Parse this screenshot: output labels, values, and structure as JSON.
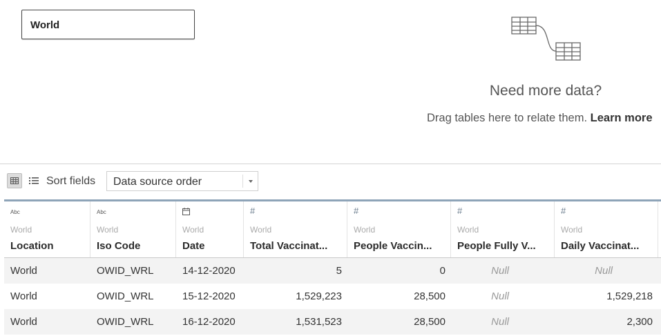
{
  "canvas": {
    "table_name": "World",
    "need_more_title": "Need more data?",
    "drag_hint": "Drag tables here to relate them.",
    "learn_more": "Learn more"
  },
  "toolbar": {
    "sort_label": "Sort fields",
    "sort_value": "Data source order"
  },
  "grid": {
    "columns": [
      {
        "type_label": "Abc",
        "source": "World",
        "name": "Location"
      },
      {
        "type_label": "Abc",
        "source": "World",
        "name": "Iso Code"
      },
      {
        "type_label": "calendar-icon",
        "source": "World",
        "name": "Date"
      },
      {
        "type_label": "#",
        "source": "World",
        "name": "Total Vaccinat..."
      },
      {
        "type_label": "#",
        "source": "World",
        "name": "People Vaccin..."
      },
      {
        "type_label": "#",
        "source": "World",
        "name": "People Fully V..."
      },
      {
        "type_label": "#",
        "source": "World",
        "name": "Daily Vaccinat..."
      }
    ],
    "rows": [
      [
        "World",
        "OWID_WRL",
        "14-12-2020",
        "5",
        "0",
        "Null",
        "Null"
      ],
      [
        "World",
        "OWID_WRL",
        "15-12-2020",
        "1,529,223",
        "28,500",
        "Null",
        "1,529,218"
      ],
      [
        "World",
        "OWID_WRL",
        "16-12-2020",
        "1,531,523",
        "28,500",
        "Null",
        "2,300"
      ]
    ]
  }
}
